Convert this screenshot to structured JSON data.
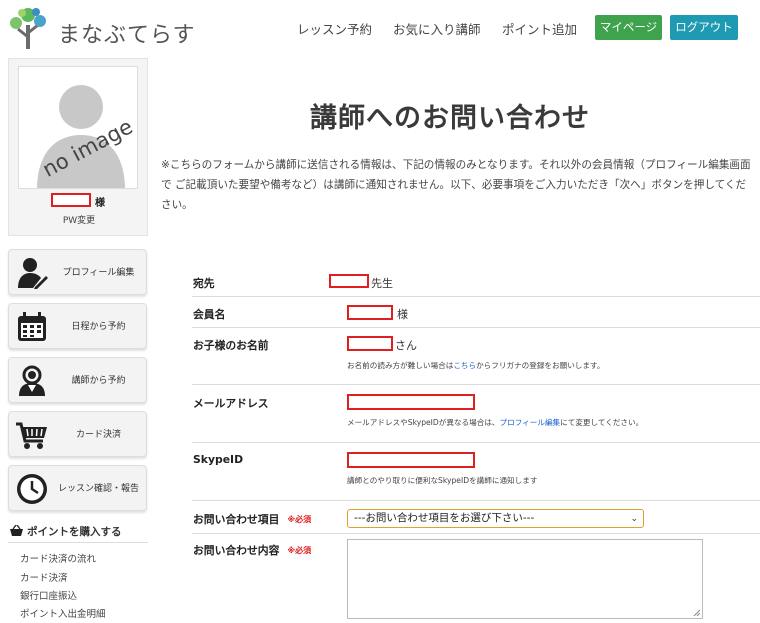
{
  "header": {
    "logo_text": "まなぶてらす",
    "nav": [
      "レッスン予約",
      "お気に入り講師",
      "ポイント追加"
    ],
    "mypage_label": "マイページ",
    "logout_label": "ログアウト"
  },
  "sidebar": {
    "avatar_text": "no image",
    "sama": "様",
    "pw_change": "PW変更",
    "buttons": [
      {
        "label": "プロフィール編集",
        "icon": "profile-edit-icon"
      },
      {
        "label": "日程から予約",
        "icon": "calendar-icon"
      },
      {
        "label": "講師から予約",
        "icon": "teacher-icon"
      },
      {
        "label": "カード決済",
        "icon": "cart-icon"
      },
      {
        "label": "レッスン確認・報告",
        "icon": "clock-icon"
      }
    ],
    "points_heading": "ポイントを購入する",
    "links": [
      "カード決済の流れ",
      "カード決済",
      "銀行口座振込",
      "ポイント入出金明細"
    ]
  },
  "main": {
    "title": "講師へのお問い合わせ",
    "intro": "※こちらのフォームから講師に送信される情報は、下記の情報のみとなります。それ以外の会員情報（プロフィール編集画面で ご記載頂いた要望や備考など）は講師に通知されません。以下、必要事項をご入力いただき「次へ」ボタンを押してください。",
    "form": {
      "to_label": "宛先",
      "to_suffix": "先生",
      "member_label": "会員名",
      "member_suffix": "様",
      "child_label": "お子様のお名前",
      "child_suffix": "さん",
      "child_note_pre": "お名前の読み方が難しい場合は",
      "child_note_link": "こちら",
      "child_note_post": "からフリガナの登録をお願いします。",
      "email_label": "メールアドレス",
      "email_note_pre": "メールアドレスやSkypeIDが異なる場合は、",
      "email_note_link": "プロフィール編集",
      "email_note_post": "にて変更してください。",
      "skype_label": "SkypeID",
      "skype_note": "講師とのやり取りに便利なSkypeIDを講師に通知します",
      "subject_label": "お問い合わせ項目",
      "subject_required": "※必須",
      "subject_selected": "---お問い合わせ項目をお選び下さい---",
      "content_label": "お問い合わせ内容",
      "content_required": "※必須"
    }
  },
  "colors": {
    "mypage_button": "#3fa34d",
    "logout_button": "#1e9bb3",
    "required": "#e02020",
    "link": "#1a5fd0"
  }
}
